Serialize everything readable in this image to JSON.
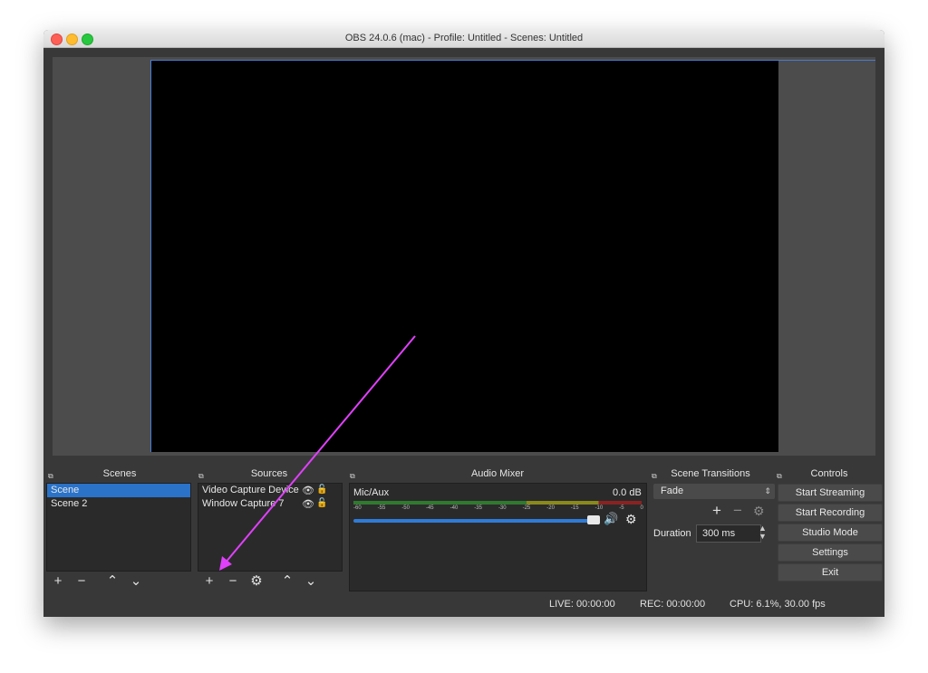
{
  "window": {
    "title": "OBS 24.0.6 (mac) - Profile: Untitled - Scenes: Untitled"
  },
  "docks": {
    "scenes": "Scenes",
    "sources": "Sources",
    "audio_mixer": "Audio Mixer",
    "scene_transitions": "Scene Transitions",
    "controls": "Controls"
  },
  "scenes": {
    "items": [
      {
        "label": "Scene"
      },
      {
        "label": "Scene 2"
      }
    ]
  },
  "sources": {
    "items": [
      {
        "label": "Video Capture Device"
      },
      {
        "label": "Window Capture 7"
      }
    ]
  },
  "audio": {
    "channel": "Mic/Aux",
    "level": "0.0 dB",
    "ticks": [
      "-60",
      "-55",
      "-50",
      "-45",
      "-40",
      "-35",
      "-30",
      "-25",
      "-20",
      "-15",
      "-10",
      "-5",
      "0"
    ],
    "volume_fraction": 1.0
  },
  "transitions": {
    "selected": "Fade",
    "duration_label": "Duration",
    "duration_value": "300 ms"
  },
  "controls": {
    "start_streaming": "Start Streaming",
    "start_recording": "Start Recording",
    "studio_mode": "Studio Mode",
    "settings": "Settings",
    "exit": "Exit"
  },
  "status": {
    "live": "LIVE: 00:00:00",
    "rec": "REC: 00:00:00",
    "cpu": "CPU: 6.1%, 30.00 fps"
  },
  "colors": {
    "accent": "#2a73c9",
    "annotation_arrow": "#e040fb"
  },
  "icons": [
    "plus-icon",
    "minus-icon",
    "chevron-up-icon",
    "chevron-down-icon",
    "gear-icon",
    "eye-icon",
    "lock-icon",
    "speaker-icon",
    "float-icon"
  ]
}
